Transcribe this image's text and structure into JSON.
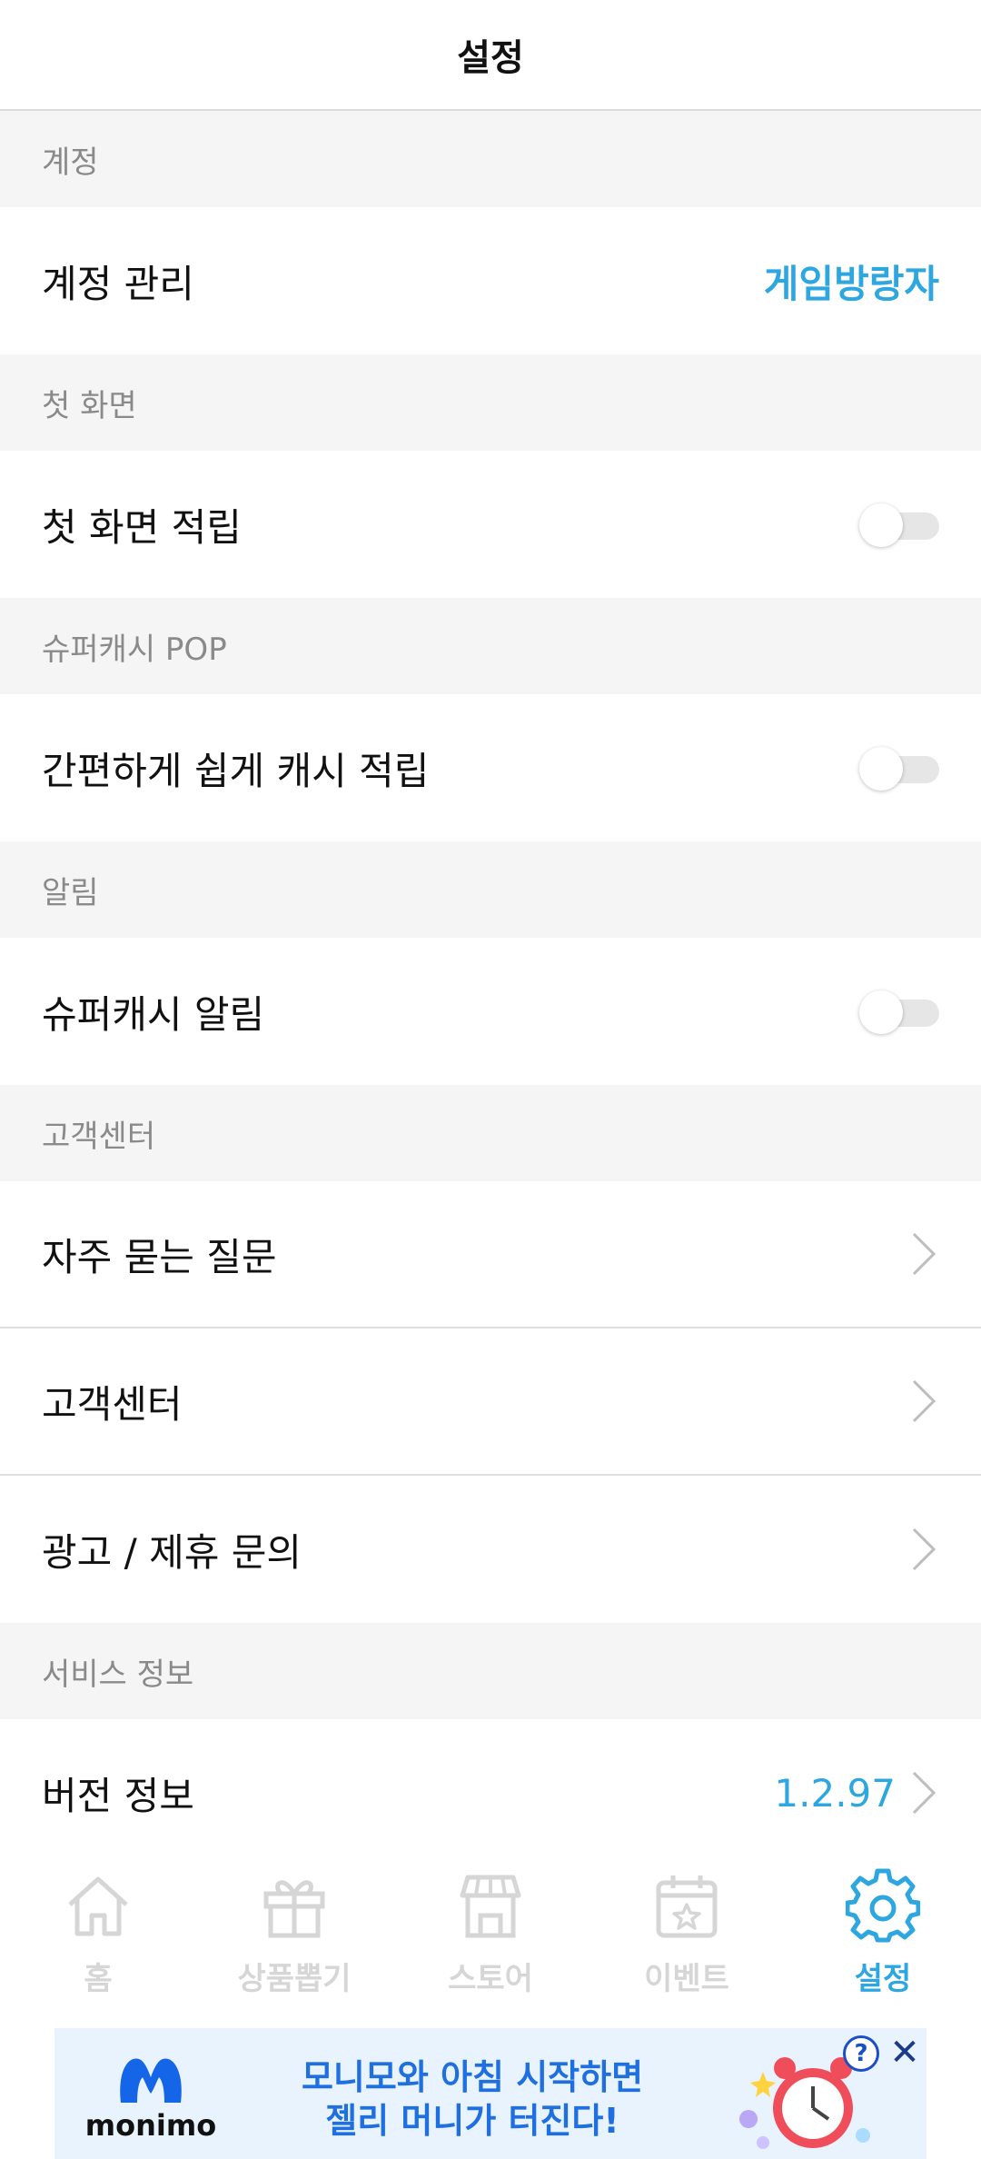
{
  "header": {
    "title": "설정"
  },
  "sections": {
    "account": {
      "label": "계정",
      "row_label": "계정 관리",
      "row_value": "게임방랑자"
    },
    "first_screen": {
      "label": "첫 화면",
      "row_label": "첫 화면 적립",
      "toggle": "off"
    },
    "supercash_pop": {
      "label": "슈퍼캐시 POP",
      "row_label": "간편하게 쉽게 캐시 적립",
      "toggle": "off"
    },
    "alarm": {
      "label": "알림",
      "row_label": "슈퍼캐시 알림",
      "toggle": "off"
    },
    "support": {
      "label": "고객센터",
      "rows": [
        "자주 묻는 질문",
        "고객센터",
        "광고 / 제휴 문의"
      ]
    },
    "service_info": {
      "label": "서비스 정보",
      "row_label": "버전 정보",
      "version": "1.2.97"
    }
  },
  "tabbar": {
    "active": "settings",
    "tabs": [
      {
        "label": "홈",
        "icon": "home-icon"
      },
      {
        "label": "상품뽑기",
        "icon": "gift-icon"
      },
      {
        "label": "스토어",
        "icon": "store-icon"
      },
      {
        "label": "이벤트",
        "icon": "calendar-star-icon"
      },
      {
        "label": "설정",
        "icon": "gear-icon"
      }
    ]
  },
  "ad": {
    "brand": "monimo",
    "line1": "모니모와 아침 시작하면",
    "line2": "젤리 머니가 터진다!",
    "help": "?",
    "close": "✕"
  },
  "colors": {
    "accent": "#2ea7e0",
    "section_bg": "#f5f5f5",
    "inactive_tab": "#d6d6d6"
  }
}
